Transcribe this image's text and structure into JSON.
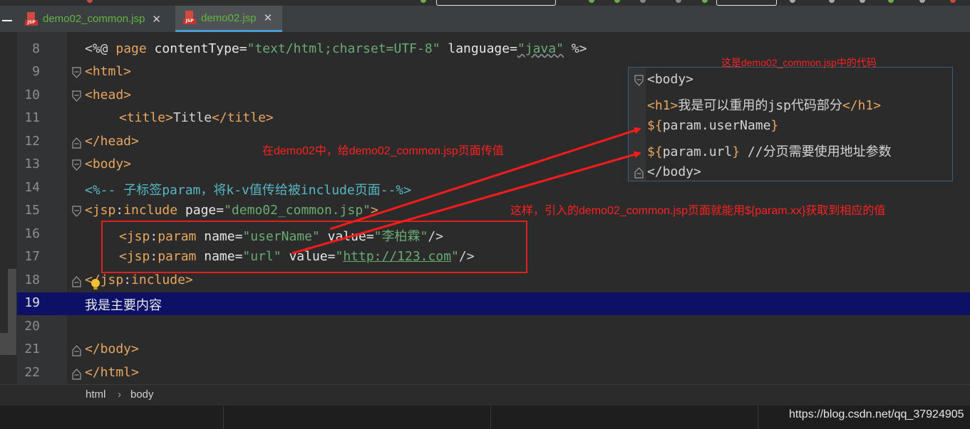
{
  "tabs": [
    {
      "label": "demo02_common.jsp",
      "close": "✕",
      "active": false
    },
    {
      "label": "demo02.jsp",
      "close": "✕",
      "active": true
    }
  ],
  "file_badge": "JSP",
  "editor": {
    "line_numbers": [
      "8",
      "9",
      "10",
      "11",
      "12",
      "13",
      "14",
      "15",
      "16",
      "17",
      "18",
      "19",
      "20",
      "21",
      "22"
    ],
    "line8": {
      "open": "<%@ ",
      "page": "page",
      "ct": " contentType=",
      "ctv": "\"text/html;charset=UTF-8\"",
      "lang": " language=",
      "langv": "\"java\"",
      "close": " %>"
    },
    "line9": "<html>",
    "line10": "<head>",
    "line11": {
      "open": "<title>",
      "text": "Title",
      "close": "</title>"
    },
    "line12": "</head>",
    "line13": "<body>",
    "line14": {
      "open": "<%--",
      "text": " 子标签param，将k-v值传给被include页面",
      "close": "--%>"
    },
    "line15": {
      "lt": "<",
      "ns": "jsp",
      "colon": ":",
      "tag": "include",
      "attr": " page=",
      "val": "\"demo02_common.jsp\"",
      "end": ">"
    },
    "line16": {
      "lt": "<",
      "ns": "jsp",
      "colon": ":",
      "tag": "param",
      "a1": " name=",
      "v1": "\"userName\"",
      "a2": " value=",
      "v2": "\"李柏霖\"",
      "end": "/>"
    },
    "line17": {
      "lt": "<",
      "ns": "jsp",
      "colon": ":",
      "tag": "param",
      "a1": " name=",
      "v1": "\"url\"",
      "a2": " value=",
      "q1": "\"",
      "link": "http://123.com",
      "q2": "\"",
      "end": "/>"
    },
    "line18": {
      "lt": "</",
      "ns": "jsp",
      "colon": ":",
      "tag": "include",
      "end": ">"
    },
    "line19": "我是主要内容",
    "line21": "</body>",
    "line22": "</html>"
  },
  "codebox": {
    "l1": "<body>",
    "l2": {
      "open": "<h1>",
      "text": "我是可以重用的jsp代码部分",
      "close": "</h1>"
    },
    "l3": {
      "d": "${",
      "v": "param.userName",
      "e": "}"
    },
    "l4": {
      "d": "${",
      "v": "param.url",
      "e": "}",
      "c": " //分页需要使用地址参数"
    },
    "l5": "</body>"
  },
  "annotations": {
    "box_title": "这是demo02_common.jsp中的代码",
    "pass": "在demo02中，给demo02_common.jsp页面传值",
    "result": "这样，引入的demo02_common.jsp页面就能用${param.xx}获取到相应的值"
  },
  "breadcrumb": [
    "html",
    "body"
  ],
  "watermark": "https://blog.csdn.net/qq_37924905",
  "colors": {
    "tag": "#e8a65f",
    "string": "#6aab73",
    "annotation": "#ff2020",
    "highlight": "#0d1166"
  }
}
